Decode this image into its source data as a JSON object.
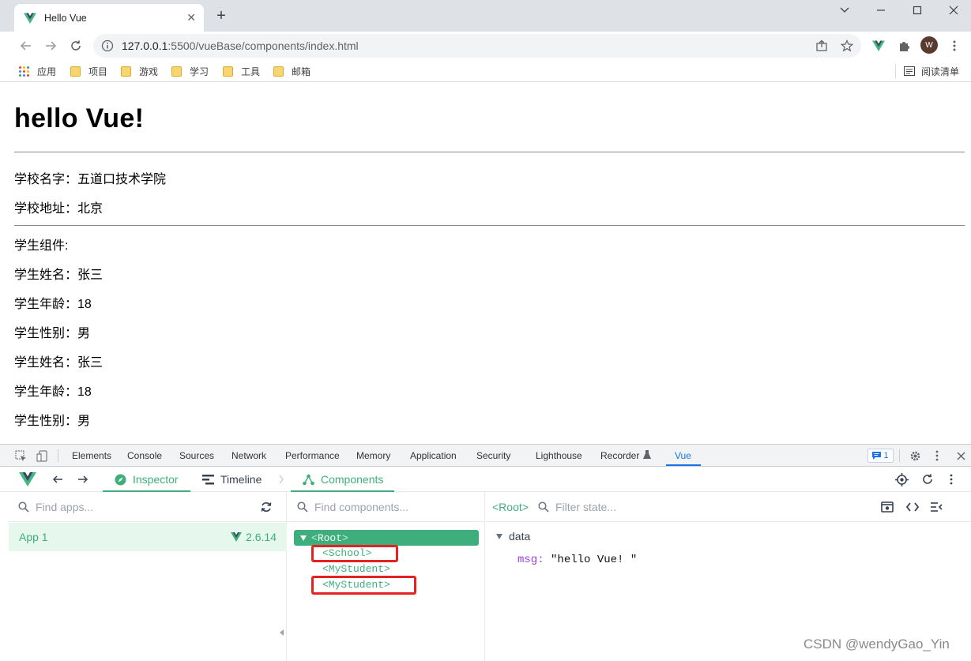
{
  "browser": {
    "tab_title": "Hello Vue",
    "url_host": "127.0.0.1",
    "url_rest": ":5500/vueBase/components/index.html",
    "avatar_letter": "W",
    "bookmarks": [
      "应用",
      "项目",
      "游戏",
      "学习",
      "工具",
      "邮箱"
    ],
    "reading_list": "阅读清单"
  },
  "page": {
    "heading": "hello Vue!",
    "school_name": "学校名字：五道口技术学院",
    "school_address": "学校地址：北京",
    "student_component": "学生组件:",
    "students": [
      {
        "name": "学生姓名：张三",
        "age": "学生年龄：18",
        "gender": "学生性别：男"
      },
      {
        "name": "学生姓名：张三",
        "age": "学生年龄：18",
        "gender": "学生性别：男"
      }
    ]
  },
  "devtools": {
    "tabs": [
      "Elements",
      "Console",
      "Sources",
      "Network",
      "Performance",
      "Memory",
      "Application",
      "Security",
      "Lighthouse",
      "Recorder",
      "Vue"
    ],
    "active_tab": "Vue",
    "message_count": "1",
    "vue": {
      "inspector_label": "Inspector",
      "timeline_label": "Timeline",
      "components_label": "Components",
      "find_apps_placeholder": "Find apps...",
      "app_name": "App 1",
      "vue_version": "2.6.14",
      "find_components_placeholder": "Find components...",
      "selected_component": "<Root>",
      "filter_state_placeholder": "Filter state...",
      "tree": {
        "root": "Root",
        "children": [
          "<School>",
          "<MyStudent>",
          "<MyStudent>"
        ]
      },
      "state": {
        "section": "data",
        "key": "msg",
        "value": "\"hello Vue! \""
      }
    }
  },
  "watermark": "CSDN @wendyGao_Yin",
  "colors": {
    "vue_green": "#3eaf7c",
    "highlight_red": "#e52222",
    "devtools_blue": "#1a73e8"
  }
}
